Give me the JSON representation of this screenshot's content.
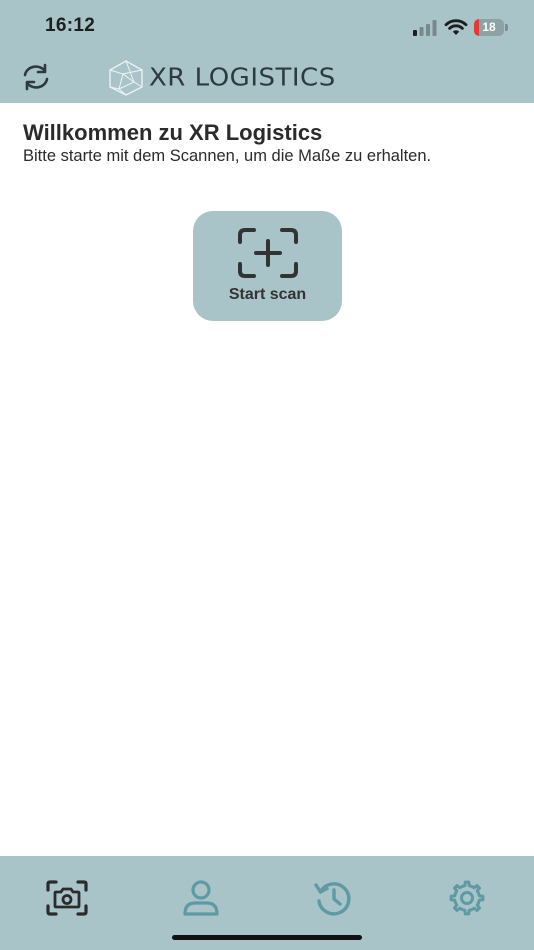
{
  "status_bar": {
    "time": "16:12",
    "battery_level": "18",
    "battery_fraction": 0.18,
    "icons": [
      "signal-icon",
      "wifi-icon",
      "battery-icon"
    ]
  },
  "header": {
    "logo_text": "XR LOGISTICS",
    "refresh_icon": "refresh-icon",
    "logo_icon": "polyhedron-logo-icon"
  },
  "main": {
    "title": "Willkommen zu XR Logistics",
    "subtitle": "Bitte starte mit dem Scannen, um die Maße zu erhalten.",
    "start_scan": {
      "label": "Start scan",
      "icon": "scan-add-icon"
    }
  },
  "tabbar": {
    "tabs": [
      {
        "icon": "camera-scan-icon",
        "active": true
      },
      {
        "icon": "user-icon",
        "active": false
      },
      {
        "icon": "history-icon",
        "active": false
      },
      {
        "icon": "settings-gear-icon",
        "active": false
      }
    ]
  },
  "colors": {
    "accent": "#a9c4c9",
    "active_icon": "#2b2b2b",
    "inactive_icon": "#5e9aa3",
    "battery_low": "#e53935"
  }
}
